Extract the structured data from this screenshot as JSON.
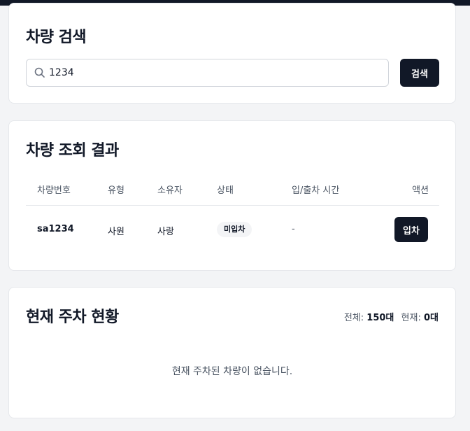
{
  "search": {
    "title": "차량 검색",
    "value": "1234",
    "button_label": "검색",
    "icon": "search-icon"
  },
  "results": {
    "title": "차량 조회 결과",
    "columns": [
      "차량번호",
      "유형",
      "소유자",
      "상태",
      "입/출차 시간",
      "액션"
    ],
    "rows": [
      {
        "plate": "sa1234",
        "type": "사원",
        "owner": "사랑",
        "status": "미입차",
        "time": "-",
        "action_label": "입차"
      }
    ]
  },
  "parking": {
    "title": "현재 주차 현황",
    "total_label": "전체:",
    "total_value": "150대",
    "current_label": "현재:",
    "current_value": "0대",
    "empty_message": "현재 주차된 차량이 없습니다."
  },
  "colors": {
    "primary": "#111827",
    "background": "#f3f4f6",
    "border": "#e5e7eb",
    "muted_text": "#4b5563"
  }
}
